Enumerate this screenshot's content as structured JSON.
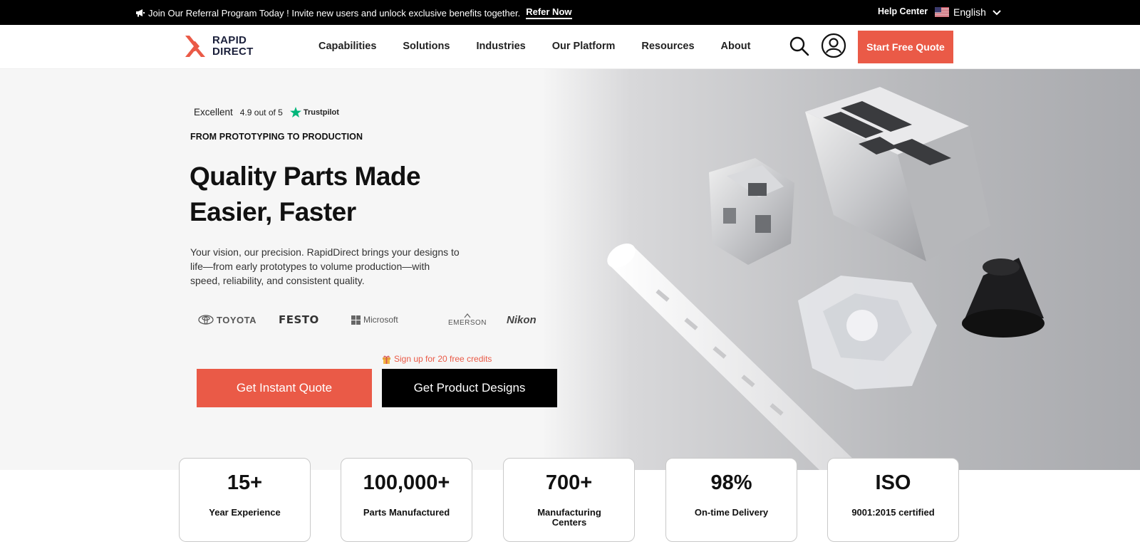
{
  "topbar": {
    "announcement": "Join Our Referral Program Today ! Invite new users and unlock exclusive benefits together.",
    "refer_label": "Refer Now",
    "help_label": "Help Center",
    "language": "English"
  },
  "nav": {
    "brand_line1": "RAPID",
    "brand_line2": "DIRECT",
    "menu": [
      "Capabilities",
      "Solutions",
      "Industries",
      "Our Platform",
      "Resources",
      "About"
    ],
    "cta_label": "Start Free Quote"
  },
  "hero": {
    "rating_word": "Excellent",
    "rating_score": "4.9 out of 5",
    "rating_source": "Trustpilot",
    "eyebrow": "FROM PROTOTYPING TO PRODUCTION",
    "headline": "Quality Parts Made Easier, Faster",
    "description": "Your vision, our precision. RapidDirect brings your designs to life—from early prototypes to volume production—with speed, reliability, and consistent quality.",
    "client_logos": [
      "TOYOTA",
      "FESTO",
      "Microsoft",
      "EMERSON",
      "Nikon"
    ],
    "credits_note": "Sign up for 20 free credits",
    "primary_button": "Get Instant Quote",
    "secondary_button": "Get Product Designs"
  },
  "stats": [
    {
      "value": "15+",
      "label": "Year Experience"
    },
    {
      "value": "100,000+",
      "label": "Parts Manufactured"
    },
    {
      "value": "700+",
      "label": "Manufacturing Centers"
    },
    {
      "value": "98%",
      "label": "On-time Delivery"
    },
    {
      "value": "ISO",
      "label": "9001:2015 certified"
    }
  ],
  "colors": {
    "accent": "#ea5a47",
    "dark": "#000000",
    "trustpilot": "#00b67a"
  }
}
